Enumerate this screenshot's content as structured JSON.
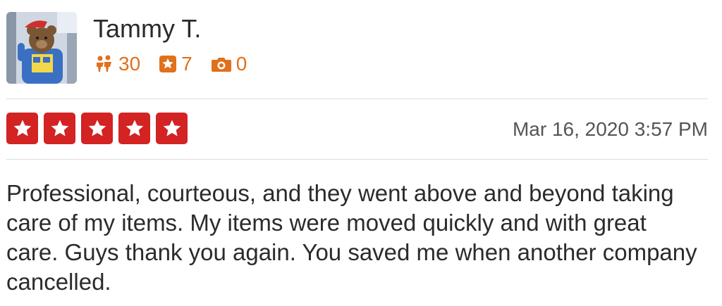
{
  "user": {
    "name": "Tammy T.",
    "avatar_icon": "teddy-bear-avatar",
    "stats": [
      {
        "icon": "friends-icon",
        "value": "30"
      },
      {
        "icon": "reviews-star-icon",
        "value": "7"
      },
      {
        "icon": "camera-icon",
        "value": "0"
      }
    ]
  },
  "rating": {
    "stars": 5,
    "max": 5,
    "color": "#d32323"
  },
  "review": {
    "date": "Mar 16, 2020 3:57 PM",
    "text": "Professional, courteous, and they went above and beyond taking care of my items. My items were moved quickly and with great care. Guys thank you again. You saved me when another company cancelled."
  },
  "colors": {
    "accent": "#e0701c",
    "star_red": "#d32323"
  }
}
